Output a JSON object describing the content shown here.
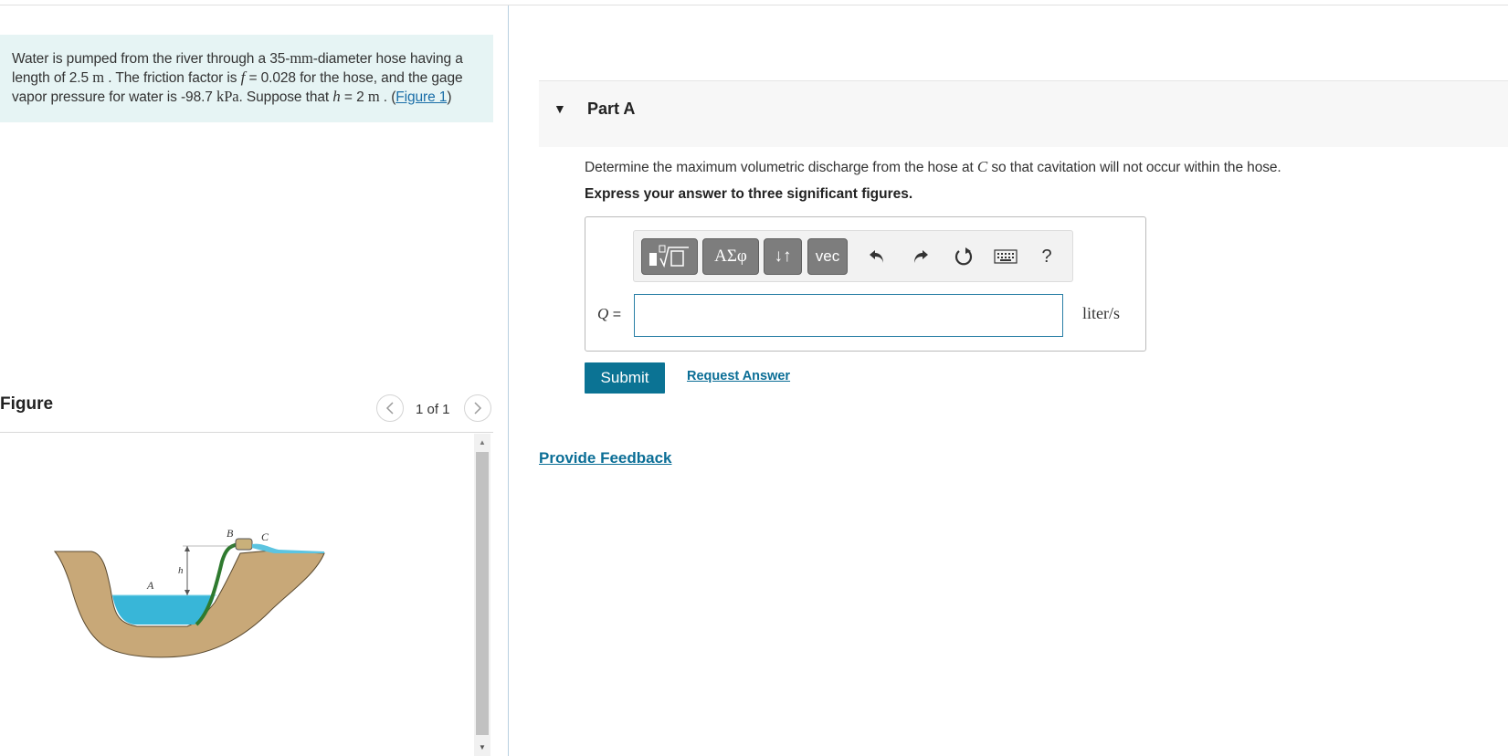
{
  "problem": {
    "t1": "Water is pumped from the river through a 35-",
    "u1": "mm",
    "t2": "-diameter hose having a length of 2.5",
    "u2": "m",
    "t3": ". The friction factor is",
    "f": "f",
    "t4": "= 0.028 for the hose, and the gage vapor pressure for water is -98.7",
    "u3": "kPa",
    "t5": ". Suppose that",
    "h": "h",
    "t6": "= 2",
    "u4": "m",
    "t7": ". (",
    "figure_link": "Figure 1",
    "t8": ")"
  },
  "figure": {
    "title": "Figure",
    "prev_icon": "chevron-left-icon",
    "next_icon": "chevron-right-icon",
    "page_indicator": "1 of 1",
    "labels": {
      "A": "A",
      "B": "B",
      "C": "C",
      "h": "h"
    }
  },
  "part": {
    "title": "Part A",
    "caret_icon": "caret-down-icon",
    "question_pre": "Determine the maximum volumetric discharge from the hose at",
    "question_var": "C",
    "question_post": "so that cavitation will not occur within the hose.",
    "instruction": "Express your answer to three significant figures."
  },
  "toolbar": {
    "templates_icon": "templates-icon",
    "greek_label": "ΑΣφ",
    "arrows_label": "↓↑",
    "vec_label": "vec",
    "undo_icon": "undo-icon",
    "redo_icon": "redo-icon",
    "reset_icon": "reset-icon",
    "keyboard_icon": "keyboard-icon",
    "help_label": "?"
  },
  "answer": {
    "variable": "Q",
    "equals": "=",
    "value": "",
    "units": "liter/s"
  },
  "actions": {
    "submit": "Submit",
    "request_answer": "Request Answer",
    "provide_feedback": "Provide Feedback"
  },
  "colors": {
    "accent": "#0b7394",
    "problem_bg": "#e6f4f4",
    "link": "#1a6ea8",
    "toolbar_button": "#7d7d7d"
  }
}
